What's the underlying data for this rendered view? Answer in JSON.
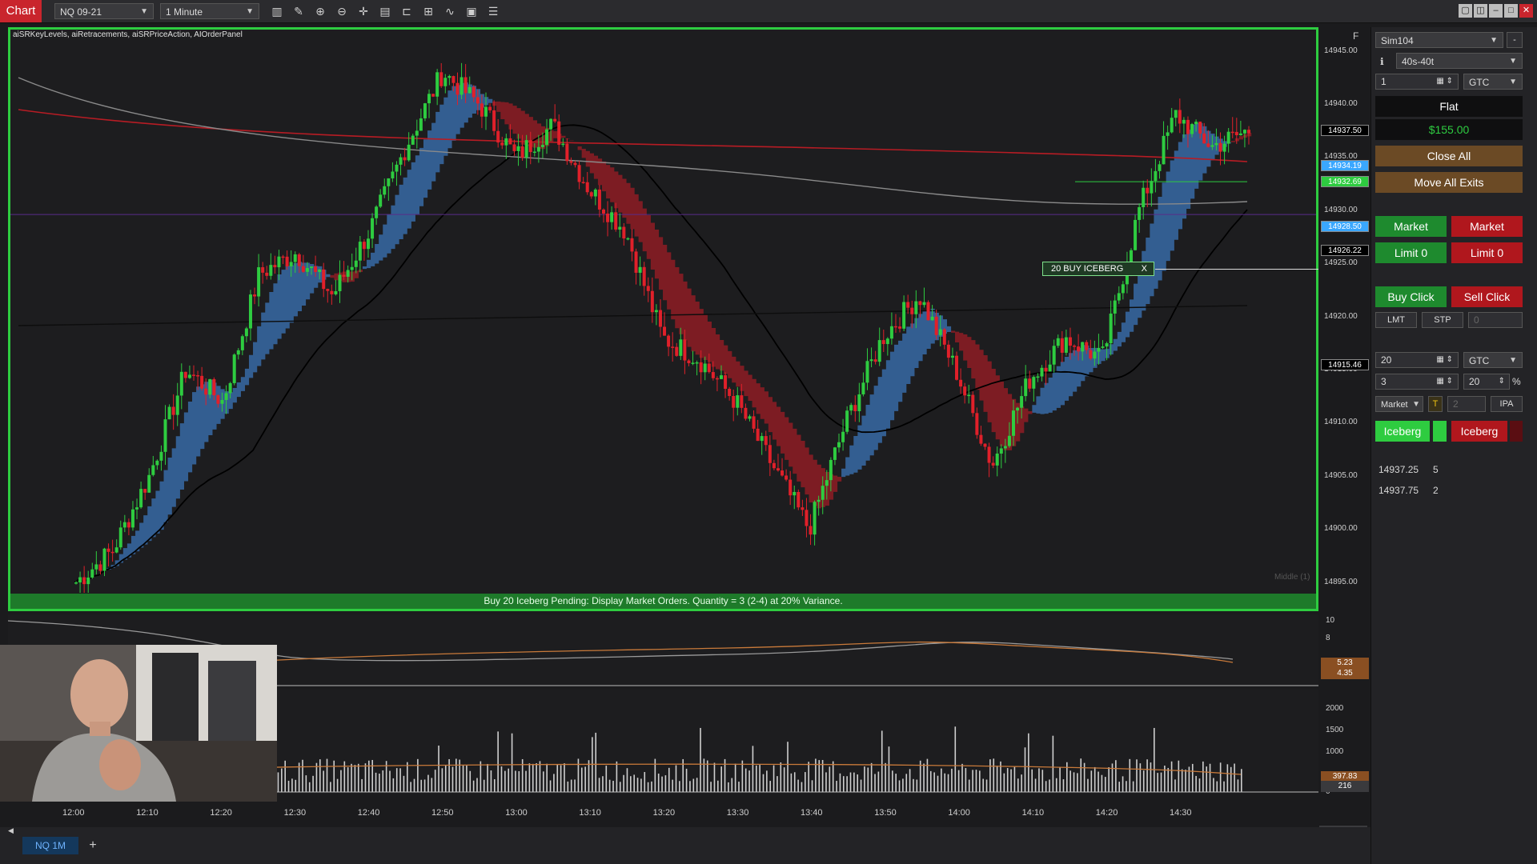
{
  "toolbar": {
    "chart_tab": "Chart",
    "instrument": "NQ 09-21",
    "interval": "1 Minute"
  },
  "chart": {
    "indicators": "aiSRKeyLevels, aiRetracements, aiSRPriceAction, AIOrderPanel",
    "panel_flag": "F",
    "price_labels": [
      "14945.00",
      "14940.00",
      "14935.00",
      "14930.00",
      "14925.00",
      "14920.00",
      "14915.00",
      "14910.00",
      "14905.00",
      "14900.00",
      "14895.00"
    ],
    "price_tags": [
      {
        "text": "14937.50",
        "bg": "#000000",
        "fg": "#ffffff"
      },
      {
        "text": "14934.19",
        "bg": "#3aa7ff",
        "fg": "#ffffff"
      },
      {
        "text": "14932.69",
        "bg": "#2ecc40",
        "fg": "#ffffff"
      },
      {
        "text": "14928.50",
        "bg": "#3aa7ff",
        "fg": "#ffffff"
      },
      {
        "text": "14926.22",
        "bg": "#000000",
        "fg": "#ffffff"
      },
      {
        "text": "14915.46",
        "bg": "#000000",
        "fg": "#ffffff"
      }
    ],
    "iceberg_marker": "20  BUY ICEBERG",
    "iceberg_marker_close": "X",
    "status_text": "Buy 20 Iceberg Pending:   Display Market Orders.  Quantity = 3 (2-4) at 20% Variance.",
    "watermark": "Middle (1)",
    "osc_labels": [
      "10",
      "8"
    ],
    "osc_tags": [
      "5.23",
      "4.35"
    ],
    "vol_labels": [
      "2000",
      "1500",
      "1000",
      "0"
    ],
    "vol_tags": [
      "397.83",
      "216"
    ],
    "time_labels": [
      "12:00",
      "12:10",
      "12:20",
      "12:30",
      "12:40",
      "12:50",
      "13:00",
      "13:10",
      "13:20",
      "13:30",
      "13:40",
      "13:50",
      "14:00",
      "14:10",
      "14:20",
      "14:30"
    ],
    "colors": {
      "up": "#2ecc40",
      "down": "#e0202a",
      "accent_green": "#2ecc40",
      "accent_red": "#c9252d",
      "blue_band": "#3b74b8",
      "red_band": "#9e1c25"
    }
  },
  "bottom": {
    "tab": "NQ 1M",
    "add": "+"
  },
  "order_panel": {
    "account": "Sim104",
    "atm": "40s-40t",
    "quantity": "1",
    "tif": "GTC",
    "position": "Flat",
    "pnl": "$155.00",
    "close_all": "Close All",
    "move_all_exits": "Move All Exits",
    "buy_market": "Market",
    "sell_market": "Market",
    "buy_limit": "Limit 0",
    "sell_limit": "Limit 0",
    "buy_click": "Buy Click",
    "sell_click": "Sell Click",
    "lmt": "LMT",
    "stp": "STP",
    "offset": "0",
    "iceberg_qty": "20",
    "iceberg_tif": "GTC",
    "display_qty": "3",
    "variance": "20",
    "percent": "%",
    "order_type": "Market",
    "t_label": "T",
    "t_value": "2",
    "ipa": "IPA",
    "iceberg_buy": "Iceberg",
    "iceberg_sell": "Iceberg",
    "dom": [
      {
        "price": "14937.25",
        "qty": "5"
      },
      {
        "price": "14937.75",
        "qty": "2"
      }
    ]
  },
  "chart_data": {
    "type": "candlestick",
    "x": [
      "11:55",
      "12:00",
      "12:05",
      "12:10",
      "12:15",
      "12:20",
      "12:25",
      "12:30",
      "12:35",
      "12:40",
      "12:45",
      "12:50",
      "12:55",
      "13:00",
      "13:05",
      "13:10",
      "13:15",
      "13:20",
      "13:25",
      "13:30",
      "13:35",
      "13:40",
      "13:45",
      "13:50",
      "13:55",
      "14:00",
      "14:05",
      "14:10",
      "14:15",
      "14:20",
      "14:25",
      "14:30",
      "14:35"
    ],
    "close": [
      14895,
      14898,
      14905,
      14915,
      14912,
      14924,
      14926,
      14922,
      14928,
      14936,
      14943,
      14940,
      14935,
      14938,
      14932,
      14928,
      14918,
      14916,
      14912,
      14906,
      14900,
      14910,
      14918,
      14922,
      14915,
      14906,
      14914,
      14918,
      14916,
      14930,
      14939,
      14936,
      14937.5
    ],
    "ylim": [
      14894,
      14947
    ]
  }
}
